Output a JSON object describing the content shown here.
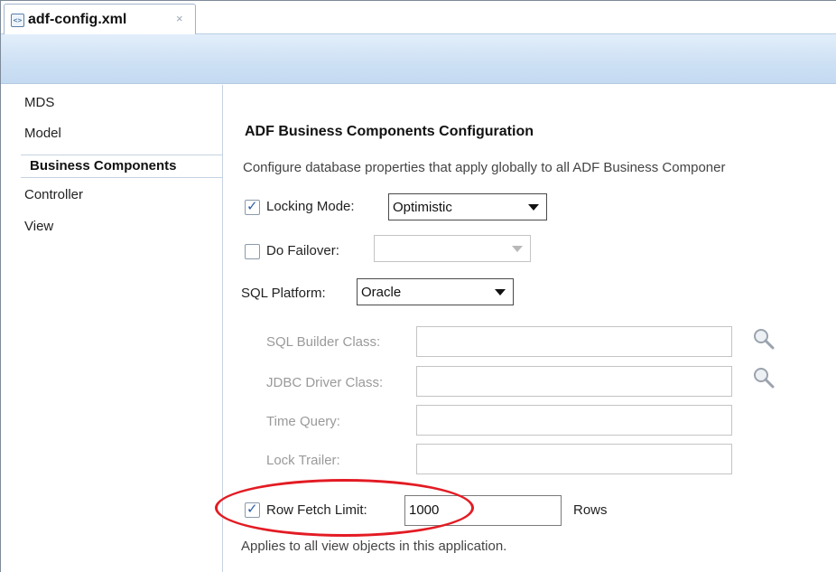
{
  "tab": {
    "title": "adf-config.xml",
    "close": "×",
    "icon": "xml-file-icon"
  },
  "nav": {
    "items": [
      {
        "label": "MDS"
      },
      {
        "label": "Model"
      },
      {
        "label": "Business Components",
        "selected": true
      },
      {
        "label": "Controller"
      },
      {
        "label": "View"
      }
    ]
  },
  "main": {
    "title": "ADF Business Components Configuration",
    "description": "Configure database properties that apply globally to all ADF Business Componer",
    "locking_mode": {
      "label": "Locking Mode:",
      "checked": true,
      "value": "Optimistic"
    },
    "do_failover": {
      "label": "Do Failover:",
      "checked": false,
      "value": ""
    },
    "sql_platform": {
      "label": "SQL Platform:",
      "value": "Oracle"
    },
    "sql_builder_class": {
      "label": "SQL Builder Class:",
      "value": ""
    },
    "jdbc_driver_class": {
      "label": "JDBC Driver Class:",
      "value": ""
    },
    "time_query": {
      "label": "Time Query:",
      "value": ""
    },
    "lock_trailer": {
      "label": "Lock Trailer:",
      "value": ""
    },
    "row_fetch_limit": {
      "label": "Row Fetch Limit:",
      "checked": true,
      "value": "1000",
      "unit": "Rows"
    },
    "footnote": "Applies to all view objects in this application."
  },
  "colors": {
    "highlight": "#e31b23",
    "header_band": "#cde0f4",
    "check": "#2b5fa8"
  }
}
